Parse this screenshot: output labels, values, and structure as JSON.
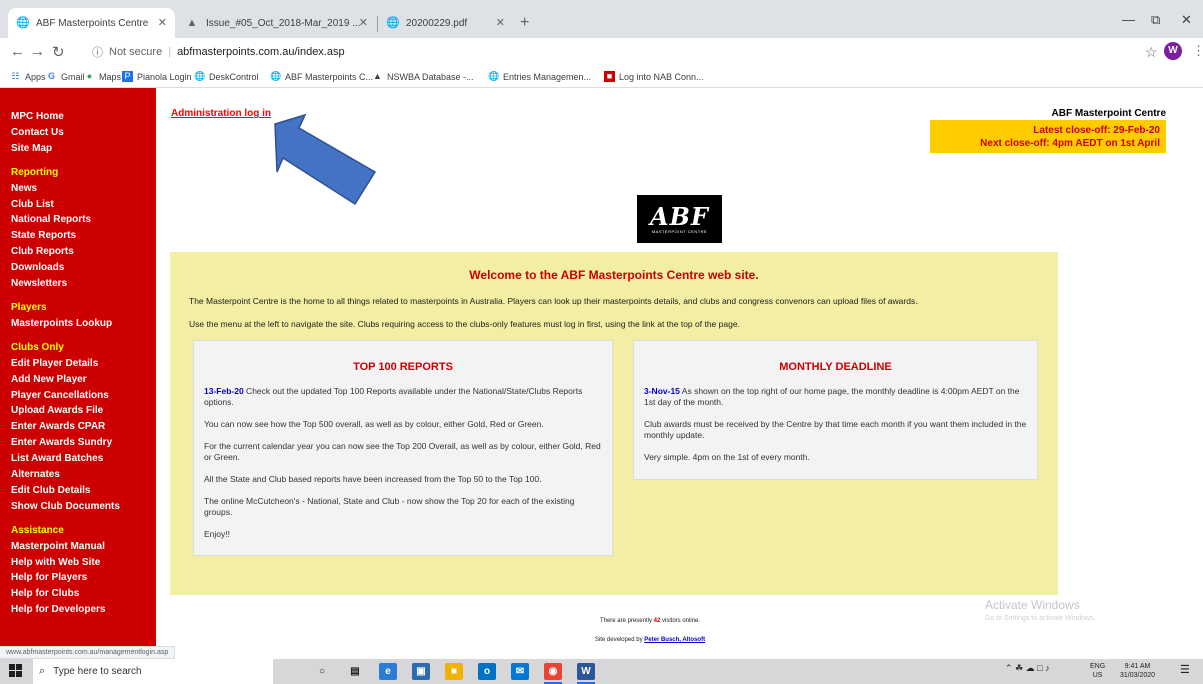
{
  "browser": {
    "tabs": [
      {
        "title": "ABF Masterpoints Centre",
        "icon": "globe-icon"
      },
      {
        "title": "Issue_#05_Oct_2018-Mar_2019 ...",
        "icon": "drive-icon"
      },
      {
        "title": "20200229.pdf",
        "icon": "globe-icon"
      }
    ],
    "new_tab": "+",
    "address": {
      "security": "Not secure",
      "url": "abfmasterpoints.com.au/index.asp"
    },
    "profile_initial": "W",
    "bookmarks": [
      {
        "label": "Apps",
        "icon": "apps-grid-icon"
      },
      {
        "label": "Gmail",
        "icon": "google-icon"
      },
      {
        "label": "Maps",
        "icon": "maps-pin-icon"
      },
      {
        "label": "Pianola Login",
        "icon": "pianola-icon"
      },
      {
        "label": "DeskControl",
        "icon": "globe-icon"
      },
      {
        "label": "ABF Masterpoints C...",
        "icon": "globe-icon"
      },
      {
        "label": "NSWBA Database -...",
        "icon": "drive-icon"
      },
      {
        "label": "Entries Managemen...",
        "icon": "globe-icon"
      },
      {
        "label": "Log into NAB Conn...",
        "icon": "nab-icon"
      }
    ],
    "status_url": "www.abfmasterpoints.com.au/managementlogin.asp"
  },
  "sidebar": {
    "group1": [
      "MPC Home",
      "Contact Us",
      "Site Map"
    ],
    "reporting": {
      "heading": "Reporting",
      "items": [
        "News",
        "Club List",
        "National Reports",
        "State Reports",
        "Club Reports",
        "Downloads",
        "Newsletters"
      ]
    },
    "players": {
      "heading": "Players",
      "items": [
        "Masterpoints Lookup"
      ]
    },
    "clubs": {
      "heading": "Clubs Only",
      "items": [
        "Edit Player Details",
        "Add New Player",
        "Player Cancellations",
        "Upload Awards File",
        "Enter Awards CPAR",
        "Enter Awards Sundry",
        "List Award Batches",
        "Alternates",
        "Edit Club Details",
        "Show Club Documents"
      ]
    },
    "assistance": {
      "heading": "Assistance",
      "items": [
        "Masterpoint Manual",
        "Help with Web Site",
        "Help for Players",
        "Help for Clubs",
        "Help for Developers"
      ]
    }
  },
  "header": {
    "admin_link": "Administration log in",
    "site_title": "ABF Masterpoint Centre",
    "latest_close": "Latest close-off: 29-Feb-20",
    "next_close": "Next close-off: 4pm AEDT on 1st April",
    "logo_text": "ABF",
    "logo_sub": "MASTERPOINT CENTRE"
  },
  "welcome": {
    "title": "Welcome to the ABF Masterpoints Centre web site.",
    "p1": "The Masterpoint Centre is the home to all things related to masterpoints in Australia. Players can look up their masterpoints details, and clubs and congress convenors can upload files of awards.",
    "p2": "Use the menu at the left to navigate the site. Clubs requiring access to the clubs-only features must log in first, using the link at the top of the page."
  },
  "top100": {
    "title": "TOP 100 REPORTS",
    "date": "13-Feb-20",
    "p1": " Check out the updated Top 100 Reports available under the National/State/Clubs Reports options.",
    "p2": "You can now see how the Top 500 overall, as well as by colour, either Gold, Red or Green.",
    "p3": "For the current calendar year you can now see the Top 200 Overall, as well as by colour, either Gold, Red or Green.",
    "p4": "All the State and Club based reports have been increased from the Top 50 to the Top 100.",
    "p5": "The online McCutcheon's - National, State and Club - now show the Top 20 for each of the existing groups.",
    "p6": "Enjoy!!"
  },
  "deadline": {
    "title": "MONTHLY DEADLINE",
    "date": "3-Nov-15",
    "p1": " As shown on the top right of our home page, the monthly deadline is 4:00pm AEDT on the 1st day of the month.",
    "p2": "Club awards must be received by the Centre by that time each month if you want them included in the monthly update.",
    "p3": "Very simple. 4pm on the 1st of every month."
  },
  "footer": {
    "visitors_pre": "There are presently ",
    "visitors_count": "42",
    "visitors_post": " visitors online.",
    "dev_pre": "Site developed by ",
    "dev_name": "Peter Busch, Altosoft"
  },
  "watermark": {
    "title": "Activate Windows",
    "sub": "Go to Settings to activate Windows."
  },
  "taskbar": {
    "search_placeholder": "Type here to search",
    "lang1": "ENG",
    "lang2": "US",
    "time": "9:41 AM",
    "date": "31/03/2020"
  },
  "colors": {
    "sidebar": "#cc0000",
    "heading_yellow": "#ffff00",
    "welcome_bg": "#f2eea3",
    "closeoff_bg": "#ffcc00",
    "arrow": "#4472c4"
  }
}
